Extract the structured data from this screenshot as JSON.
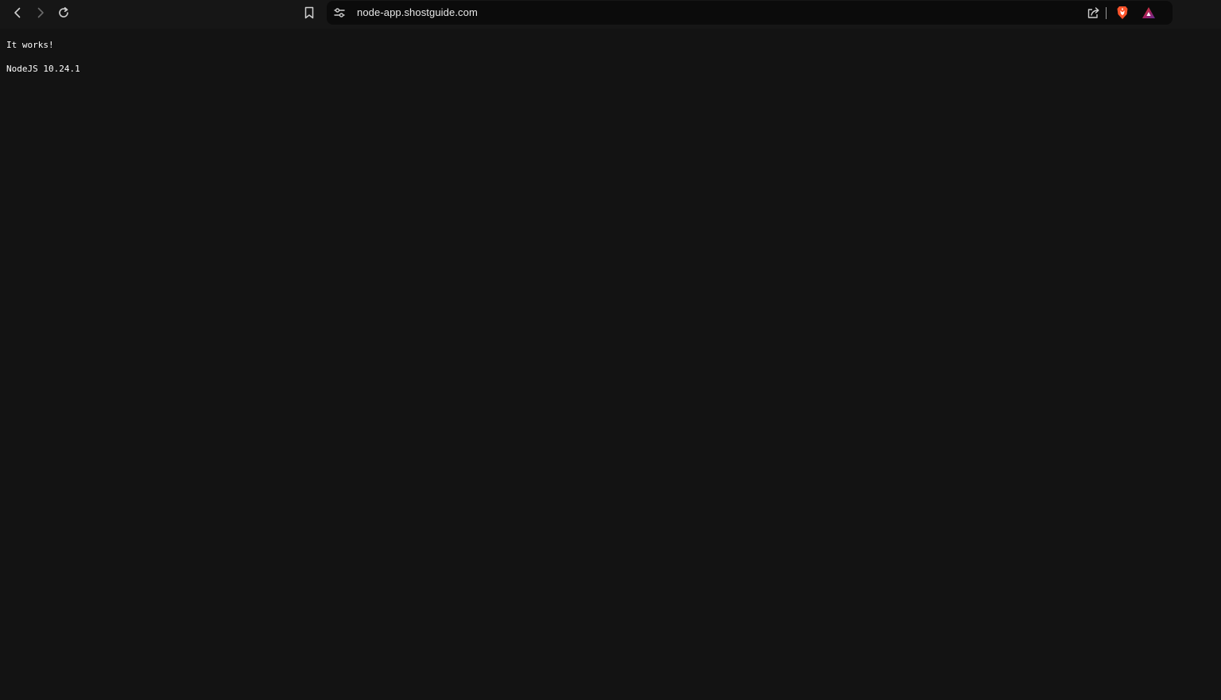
{
  "browser": {
    "url": "node-app.shostguide.com",
    "icons": {
      "back": "chevron-left-icon",
      "forward": "chevron-right-icon",
      "reload": "reload-icon",
      "bookmark": "bookmark-icon",
      "site_settings": "site-settings-icon",
      "share": "share-icon",
      "shields": "brave-shields-icon",
      "rewards": "brave-rewards-icon"
    },
    "colors": {
      "toolbar": "#161616",
      "omnibox": "#0b0b0b",
      "shields": "#fb542b",
      "page_background": "#131313",
      "text": "#ffffff"
    }
  },
  "page": {
    "lines": [
      "It works!",
      "NodeJS 10.24.1"
    ]
  }
}
